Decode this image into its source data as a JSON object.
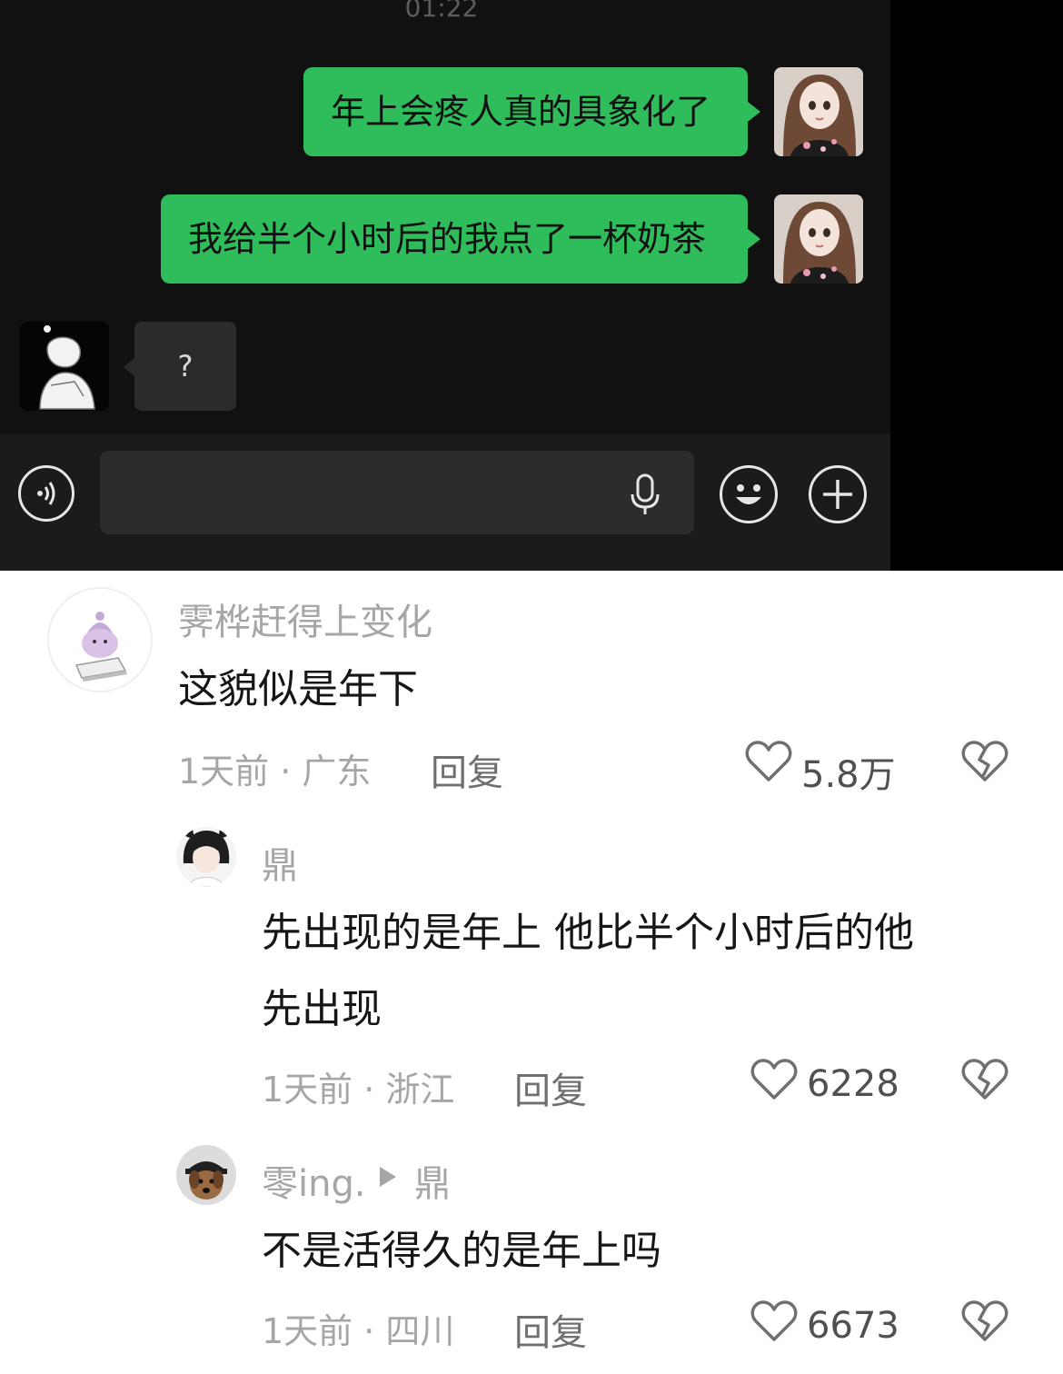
{
  "chat": {
    "time": "01:22",
    "messages": [
      {
        "side": "right",
        "text": "年上会疼人真的具象化了"
      },
      {
        "side": "right",
        "text": "我给半个小时后的我点了一杯奶茶"
      },
      {
        "side": "left",
        "text": "?"
      }
    ],
    "input_bar": {
      "left_icon": "voice-toggle-icon",
      "mic_icon": "microphone-icon",
      "emoji_icon": "emoji-icon",
      "plus_icon": "plus-icon"
    }
  },
  "comments": [
    {
      "user": "霁桦赶得上变化",
      "text": "这貌似是年下",
      "meta": "1天前 · 广东",
      "reply_label": "回复",
      "likes": "5.8万"
    },
    {
      "user": "鼎",
      "text_line1": "先出现的是年上 他比半个小时后的他",
      "text_line2": "先出现",
      "meta": "1天前 · 浙江",
      "reply_label": "回复",
      "likes": "6228"
    },
    {
      "user": "零ing.",
      "reply_to": "鼎",
      "text": "不是活得久的是年上吗",
      "meta": "1天前 · 四川",
      "reply_label": "回复",
      "likes": "6673"
    }
  ],
  "colors": {
    "bubble_green": "#2fbd5c",
    "chat_bg": "#111111",
    "muted_text": "#a6a6a6"
  }
}
